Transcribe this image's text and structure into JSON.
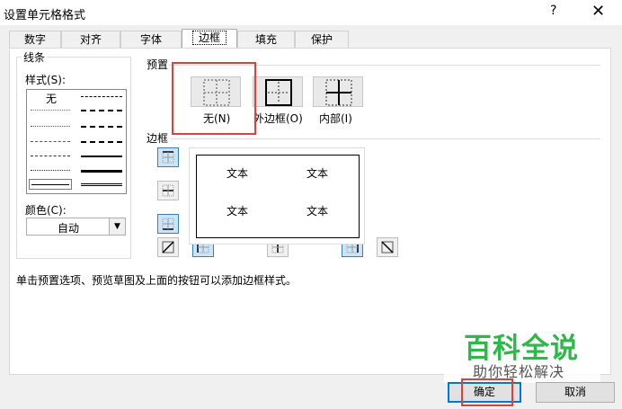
{
  "window": {
    "title": "设置单元格格式",
    "help": "?",
    "close": "✕"
  },
  "tabs": [
    {
      "label": "数字"
    },
    {
      "label": "对齐"
    },
    {
      "label": "字体"
    },
    {
      "label": "边框"
    },
    {
      "label": "填充"
    },
    {
      "label": "保护"
    }
  ],
  "active_tab": "边框",
  "line": {
    "group_label": "线条",
    "style_label": "样式(S):",
    "none_label": "无",
    "color_label": "颜色(C):",
    "color_value": "自动"
  },
  "presets": {
    "label": "预置",
    "items": [
      {
        "label": "无(N)"
      },
      {
        "label": "外边框(O)"
      },
      {
        "label": "内部(I)"
      }
    ]
  },
  "border": {
    "label": "边框",
    "preview_text": [
      "文本",
      "文本",
      "文本",
      "文本"
    ]
  },
  "hint": "单击预置选项、预览草图及上面的按钮可以添加边框样式。",
  "buttons": {
    "ok": "确定",
    "cancel": "取消"
  },
  "watermark": {
    "line1": "百科全说",
    "line2": "助你轻松解决"
  },
  "colors": {
    "highlight": "#e0403a",
    "selected_fill": "#cce4f7",
    "watermark_green": "#2db84a"
  }
}
